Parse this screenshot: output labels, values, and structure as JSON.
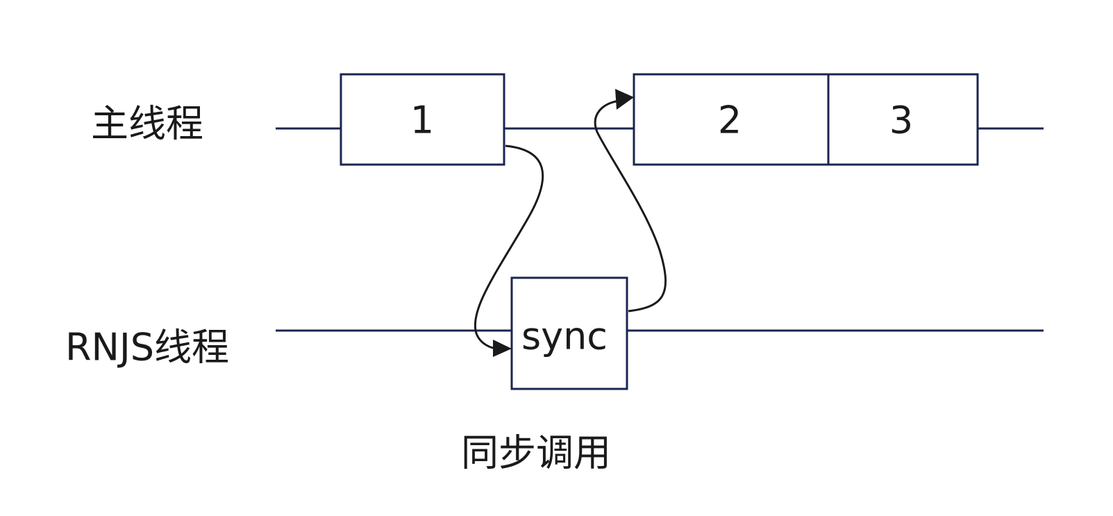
{
  "lanes": {
    "main_thread": "主线程",
    "rnjs_thread": "RNJS线程"
  },
  "tasks": {
    "task_1": "1",
    "task_2": "2",
    "task_3": "3",
    "sync": "sync"
  },
  "caption": "同步调用",
  "colors": {
    "line": "#1b2550",
    "text": "#1a1a1a",
    "background": "#ffffff"
  }
}
